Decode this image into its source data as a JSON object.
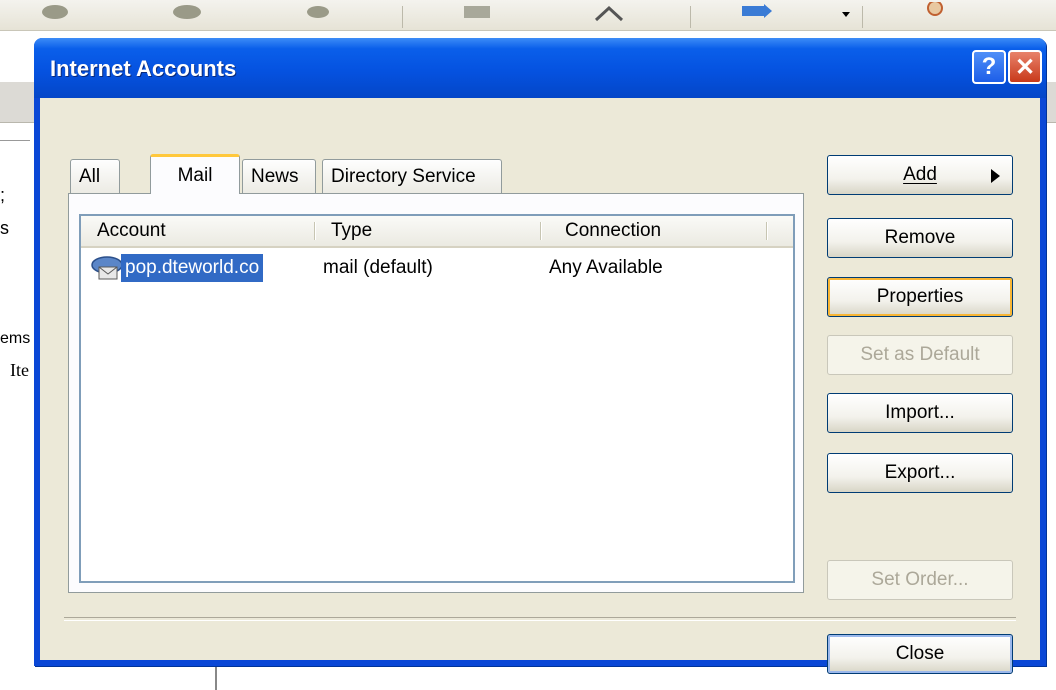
{
  "background": {
    "left_fragments": [
      ";",
      "s",
      "ems",
      "Ite"
    ]
  },
  "dialog": {
    "title": "Internet Accounts",
    "help_glyph": "?",
    "close_glyph": "✕",
    "tabs": [
      {
        "label": "All",
        "active": false
      },
      {
        "label": "Mail",
        "active": true
      },
      {
        "label": "News",
        "active": false
      },
      {
        "label": "Directory Service",
        "active": false
      }
    ],
    "list": {
      "columns": [
        "Account",
        "Type",
        "Connection"
      ],
      "rows": [
        {
          "account": "pop.dteworld.co",
          "type": "mail (default)",
          "connection": "Any Available",
          "selected": true
        }
      ]
    },
    "buttons": {
      "add": "Add",
      "remove": "Remove",
      "properties": "Properties",
      "set_default": "Set as Default",
      "import": "Import...",
      "export": "Export...",
      "set_order": "Set Order...",
      "close": "Close"
    },
    "colors": {
      "title_bar": "#0552e0",
      "selection": "#316ac5",
      "active_tab_accent": "#ffc83c",
      "focus_ring": "#f8b636"
    }
  }
}
